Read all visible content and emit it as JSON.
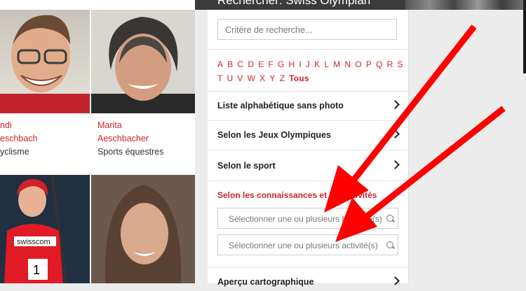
{
  "panel": {
    "title": "Rechercher: Swiss Olympian",
    "search_placeholder": "Critère de recherche...",
    "letters": [
      "A",
      "B",
      "C",
      "D",
      "E",
      "F",
      "G",
      "H",
      "I",
      "J",
      "K",
      "L",
      "M",
      "N",
      "O",
      "P",
      "Q",
      "R",
      "S",
      "T",
      "U",
      "V",
      "W",
      "X",
      "Y",
      "Z"
    ],
    "tous": "Tous",
    "rows": [
      {
        "label": "Liste alphabétique sans photo"
      },
      {
        "label": "Selon les Jeux Olympiques"
      },
      {
        "label": "Selon le sport"
      }
    ],
    "skills_title": "Selon les connaissances et les activités",
    "select_branches": "Sélectionner une ou plusieurs branche(s)",
    "select_activities": "Sélectionner une ou plusieurs activité(s)",
    "map_row": "Aperçu cartographique"
  },
  "athletes": [
    {
      "first": "ndi",
      "last": "eschbach",
      "sport": "yclisme"
    },
    {
      "first": "Marita",
      "last": "Aeschbacher",
      "sport": "Sports équestres"
    }
  ],
  "colors": {
    "accent": "#d1242c",
    "arrow": "#ff0000"
  }
}
